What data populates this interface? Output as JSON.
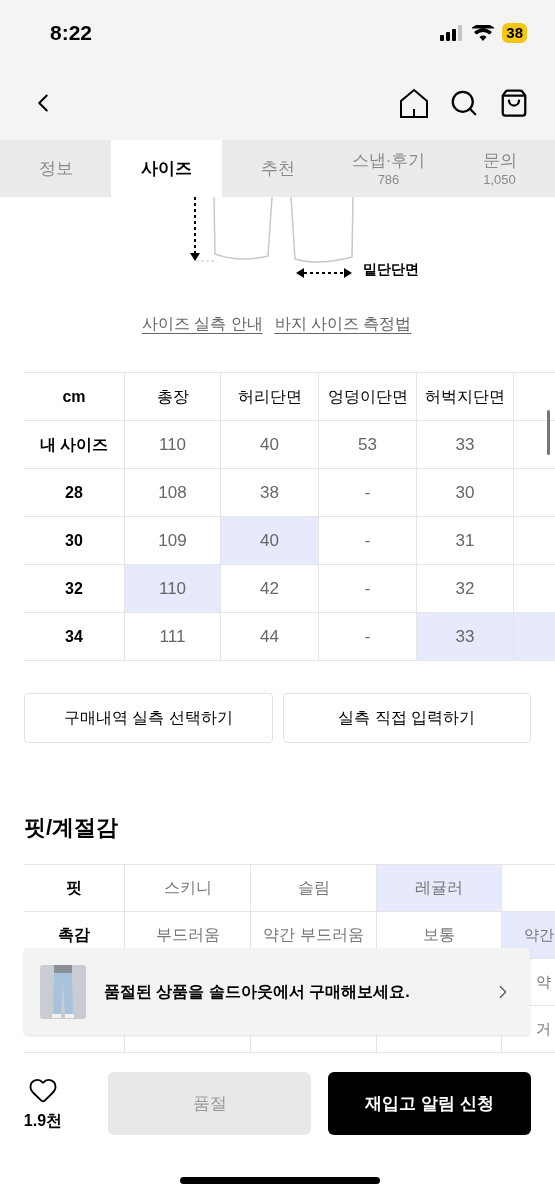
{
  "status_bar": {
    "time": "8:22",
    "battery": "38"
  },
  "tabs": [
    {
      "label": "정보",
      "selected": false
    },
    {
      "label": "사이즈",
      "selected": true
    },
    {
      "label": "추천",
      "selected": false
    },
    {
      "label": "스냅·후기",
      "count": "786",
      "selected": false
    },
    {
      "label": "문의",
      "count": "1,050",
      "selected": false
    }
  ],
  "diagram": {
    "label": "밑단단면"
  },
  "links": [
    "사이즈 실측 안내",
    "바지 사이즈 측정법"
  ],
  "size_table": {
    "corner": "cm",
    "columns": [
      "총장",
      "허리단면",
      "엉덩이단면",
      "허벅지단면"
    ],
    "rows": [
      {
        "label": "내 사이즈",
        "cells": [
          {
            "text": "110",
            "selected": false
          },
          {
            "text": "40",
            "selected": false
          },
          {
            "text": "53",
            "selected": false
          },
          {
            "text": "33",
            "selected": false
          },
          {
            "selected": false
          }
        ]
      },
      {
        "label": "28",
        "cells": [
          {
            "text": "108",
            "selected": false
          },
          {
            "text": "38",
            "selected": false
          },
          {
            "text": "-",
            "selected": false
          },
          {
            "text": "30",
            "selected": false
          },
          {
            "selected": false
          }
        ]
      },
      {
        "label": "30",
        "cells": [
          {
            "text": "109",
            "selected": false
          },
          {
            "text": "40",
            "selected": true
          },
          {
            "text": "-",
            "selected": false
          },
          {
            "text": "31",
            "selected": false
          },
          {
            "selected": false
          }
        ]
      },
      {
        "label": "32",
        "cells": [
          {
            "text": "110",
            "selected": true
          },
          {
            "text": "42",
            "selected": false
          },
          {
            "text": "-",
            "selected": false
          },
          {
            "text": "32",
            "selected": false
          },
          {
            "selected": false
          }
        ]
      },
      {
        "label": "34",
        "cells": [
          {
            "text": "111",
            "selected": false
          },
          {
            "text": "44",
            "selected": false
          },
          {
            "text": "-",
            "selected": false
          },
          {
            "text": "33",
            "selected": true
          },
          {
            "selected": true
          }
        ]
      }
    ]
  },
  "size_buttons": [
    "구매내역 실측 선택하기",
    "실측 직접 입력하기"
  ],
  "fit_section": {
    "title": "핏/계절감",
    "rows": [
      {
        "label": "핏",
        "cells": [
          {
            "text": "스키니",
            "selected": false
          },
          {
            "text": "슬림",
            "selected": false
          },
          {
            "text": "레귤러",
            "selected": true
          },
          {
            "selected": false
          }
        ]
      },
      {
        "label": "촉감",
        "cells": [
          {
            "text": "부드러움",
            "selected": false
          },
          {
            "text": "약간 부드러움",
            "selected": false
          },
          {
            "text": "보통",
            "selected": false
          },
          {
            "text": "약간",
            "selected": true
          }
        ]
      },
      {
        "cells": [
          {
            "text": "약",
            "selected": false
          }
        ]
      },
      {
        "cells": [
          {
            "text": "거",
            "selected": false
          }
        ]
      }
    ]
  },
  "banner": {
    "text": "품절된 상품을 솔드아웃에서 구매해보세요."
  },
  "bottom_bar": {
    "likes": "1.9천",
    "sold_out": {
      "label": "품절",
      "disabled": true
    },
    "restock": "재입고 알림 신청"
  }
}
